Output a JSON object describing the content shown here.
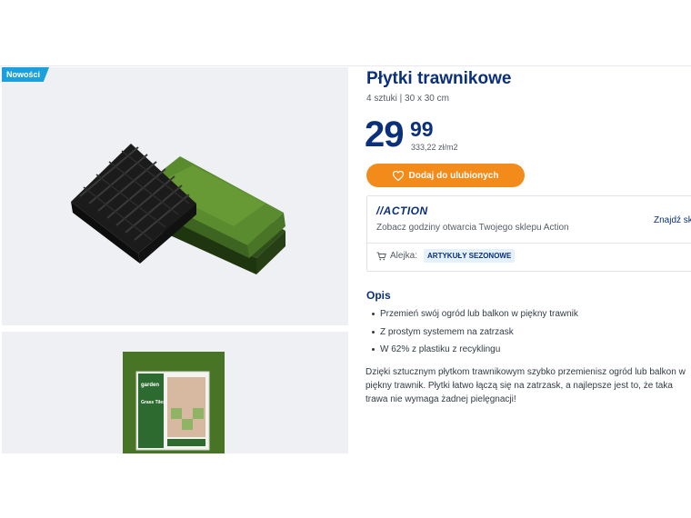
{
  "gallery": {
    "badge": "Nowości",
    "package": {
      "brand": "garden",
      "name": "Grass Tiles"
    }
  },
  "product": {
    "title": "Płytki trawnikowe",
    "subtitle": "4 sztuki | 30 x 30 cm",
    "price_integer": "29",
    "price_decimal": "99",
    "unit_price": "333,22 zł/m2",
    "favorite_label": "Dodaj do ulubionych"
  },
  "store": {
    "logo": "//ACTION",
    "hours_text": "Zobacz godziny otwarcia Twojego sklepu Action",
    "find_store": "Znajdź sk",
    "aisle_label": "Alejka:",
    "aisle_badge": "ARTYKUŁY SEZONOWE"
  },
  "description": {
    "heading": "Opis",
    "bullets": [
      "Przemień swój ogród lub balkon w piękny trawnik",
      "Z prostym systemem na zatrzask",
      "W 62% z plastiku z recyklingu"
    ],
    "body": "Dzięki sztucznym płytkom trawnikowym szybko przemienisz ogród lub balkon w piękny trawnik. Płytki łatwo łączą się na zatrzask, a najlepsze jest to, że taka trawa nie wymaga żadnej pielęgnacji!"
  },
  "colors": {
    "brand_blue": "#0a2f7c",
    "button_orange": "#f28b1a",
    "badge_blue": "#1aa0dd",
    "grass_green": "#4f7d2a"
  }
}
